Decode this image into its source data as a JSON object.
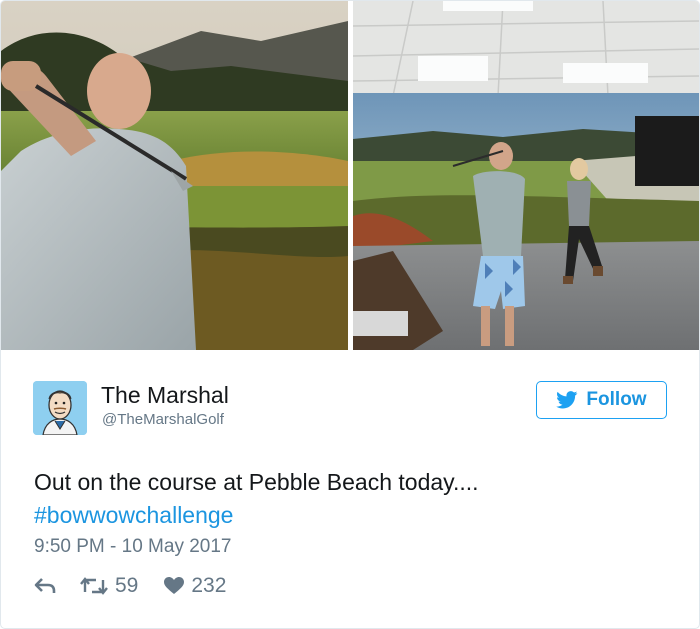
{
  "photos": [
    {
      "description_icon": "golfer-photo-closeup"
    },
    {
      "description_icon": "golfer-photo-wide"
    }
  ],
  "user": {
    "name": "The Marshal",
    "handle": "@TheMarshalGolf",
    "avatar_icon": "cartoon-marshal-avatar"
  },
  "follow": {
    "label": "Follow",
    "icon": "twitter-bird-icon",
    "color": "#1da1f2"
  },
  "tweet": {
    "text": "Out on the course at Pebble Beach today....",
    "hashtag": "#bowwowchallenge",
    "timestamp": "9:50 PM - 10 May 2017"
  },
  "actions": {
    "reply_icon": "reply-icon",
    "retweet_icon": "retweet-icon",
    "retweet_count": "59",
    "like_icon": "heart-icon",
    "like_count": "232"
  },
  "colors": {
    "link": "#1b95e0",
    "muted": "#657786",
    "text": "#14171a",
    "border": "#e1e8ed"
  }
}
